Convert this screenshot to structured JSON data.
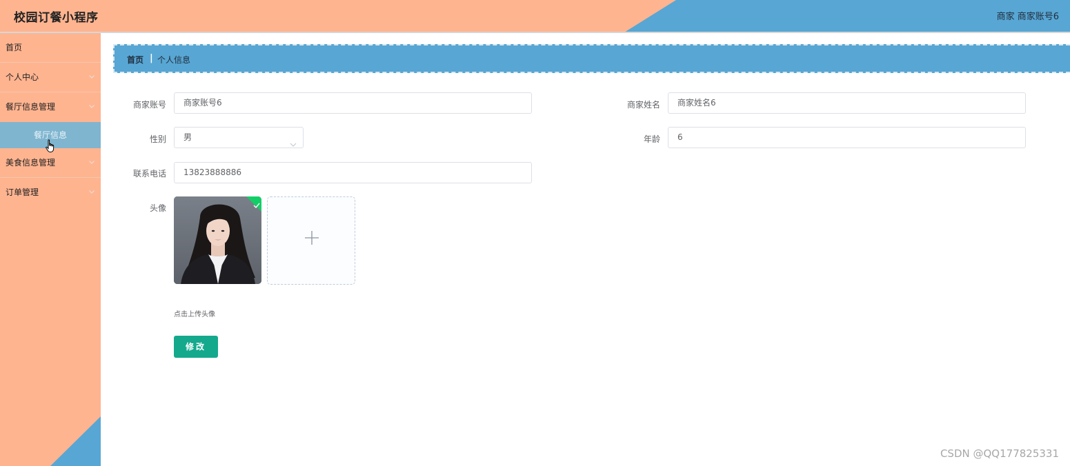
{
  "header": {
    "app_title": "校园订餐小程序",
    "user_info": "商家 商家账号6",
    "colors": {
      "primary": "#58a6d3",
      "accent": "#ffb490"
    }
  },
  "sidebar": {
    "items": [
      {
        "label": "首页",
        "has_children": false
      },
      {
        "label": "个人中心",
        "has_children": true
      },
      {
        "label": "餐厅信息管理",
        "has_children": true
      },
      {
        "label": "美食信息管理",
        "has_children": true
      },
      {
        "label": "订单管理",
        "has_children": true
      }
    ],
    "submenu_active": {
      "label": "餐厅信息"
    }
  },
  "breadcrumb": {
    "home": "首页",
    "separator": "|",
    "current": "个人信息"
  },
  "form": {
    "account_label": "商家账号",
    "account_value": "商家账号6",
    "name_label": "商家姓名",
    "name_value": "商家姓名6",
    "gender_label": "性别",
    "gender_value": "男",
    "age_label": "年龄",
    "age_value": "6",
    "phone_label": "联系电话",
    "phone_value": "13823888886",
    "avatar_label": "头像",
    "upload_tip": "点击上传头像",
    "submit_label": "修改"
  },
  "watermark": "CSDN @QQ177825331"
}
